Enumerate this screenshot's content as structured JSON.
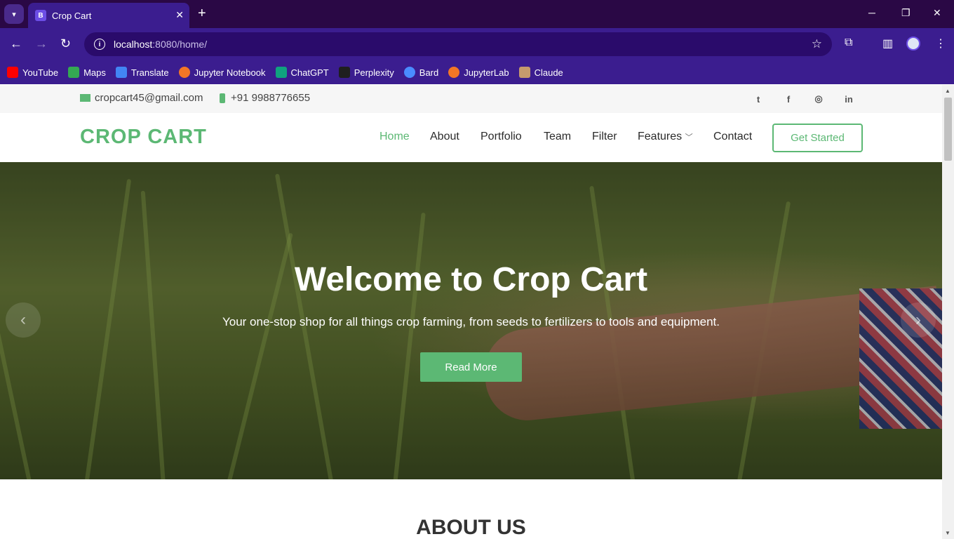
{
  "browser": {
    "tab_title": "Crop Cart",
    "tab_favicon": "B",
    "url_host": "localhost",
    "url_path": ":8080/home/",
    "bookmarks": [
      {
        "label": "YouTube",
        "color": "#ff0000"
      },
      {
        "label": "Maps",
        "color": "#34a853"
      },
      {
        "label": "Translate",
        "color": "#4285f4"
      },
      {
        "label": "Jupyter Notebook",
        "color": "#f37626"
      },
      {
        "label": "ChatGPT",
        "color": "#10a37f"
      },
      {
        "label": "Perplexity",
        "color": "#1f1f1f"
      },
      {
        "label": "Bard",
        "color": "#4a8cff"
      },
      {
        "label": "JupyterLab",
        "color": "#f37626"
      },
      {
        "label": "Claude",
        "color": "#c69a6d"
      }
    ]
  },
  "topbar": {
    "email": "cropcart45@gmail.com",
    "phone": "+91 9988776655",
    "social": [
      "twitter-icon",
      "facebook-icon",
      "instagram-icon",
      "linkedin-icon"
    ]
  },
  "header": {
    "logo": "CROP CART",
    "nav": [
      "Home",
      "About",
      "Portfolio",
      "Team",
      "Filter",
      "Features",
      "Contact"
    ],
    "cta": "Get Started"
  },
  "hero": {
    "title": "Welcome to Crop Cart",
    "subtitle": "Your one-stop shop for all things crop farming, from seeds to fertilizers to tools and equipment.",
    "button": "Read More"
  },
  "about": {
    "heading": "ABOUT US"
  },
  "colors": {
    "accent": "#5cb874",
    "browser": "#3b1d8f"
  }
}
